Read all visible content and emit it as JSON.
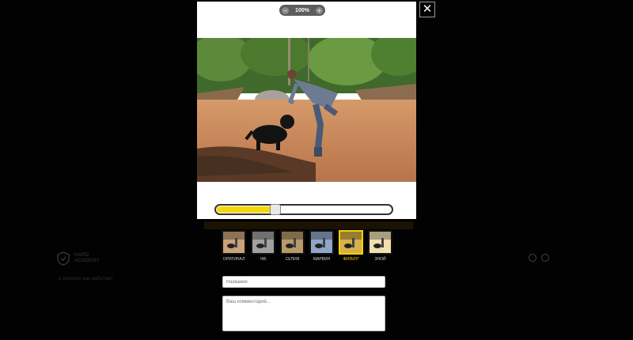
{
  "background": {
    "logo_line1": "hard",
    "logo_line2": "academy",
    "link_text": "о проекте как работает"
  },
  "editor": {
    "zoom": {
      "minus": "–",
      "value": "100%",
      "plus": "+"
    },
    "close_label": "✕",
    "photo_alt": "Man walking a black dog on a sandy riverbank",
    "slider": {
      "fill_fraction": 0.32
    },
    "filters": [
      {
        "label": "оригинал",
        "selected": false,
        "tint": "#c8a27a"
      },
      {
        "label": "ч/б",
        "selected": false,
        "tint": "#a0a0a0"
      },
      {
        "label": "сепия",
        "selected": false,
        "tint": "#b89a6a"
      },
      {
        "label": "марвин",
        "selected": false,
        "tint": "#8fa6c8"
      },
      {
        "label": "фильтр",
        "selected": true,
        "tint": "#d8b04a"
      },
      {
        "label": "зной",
        "selected": false,
        "tint": "#f0e0b0"
      }
    ],
    "title_placeholder": "Название",
    "comment_placeholder": "Ваш комментарий..."
  },
  "colors": {
    "accent": "#f5d80b",
    "background": "#020202"
  }
}
